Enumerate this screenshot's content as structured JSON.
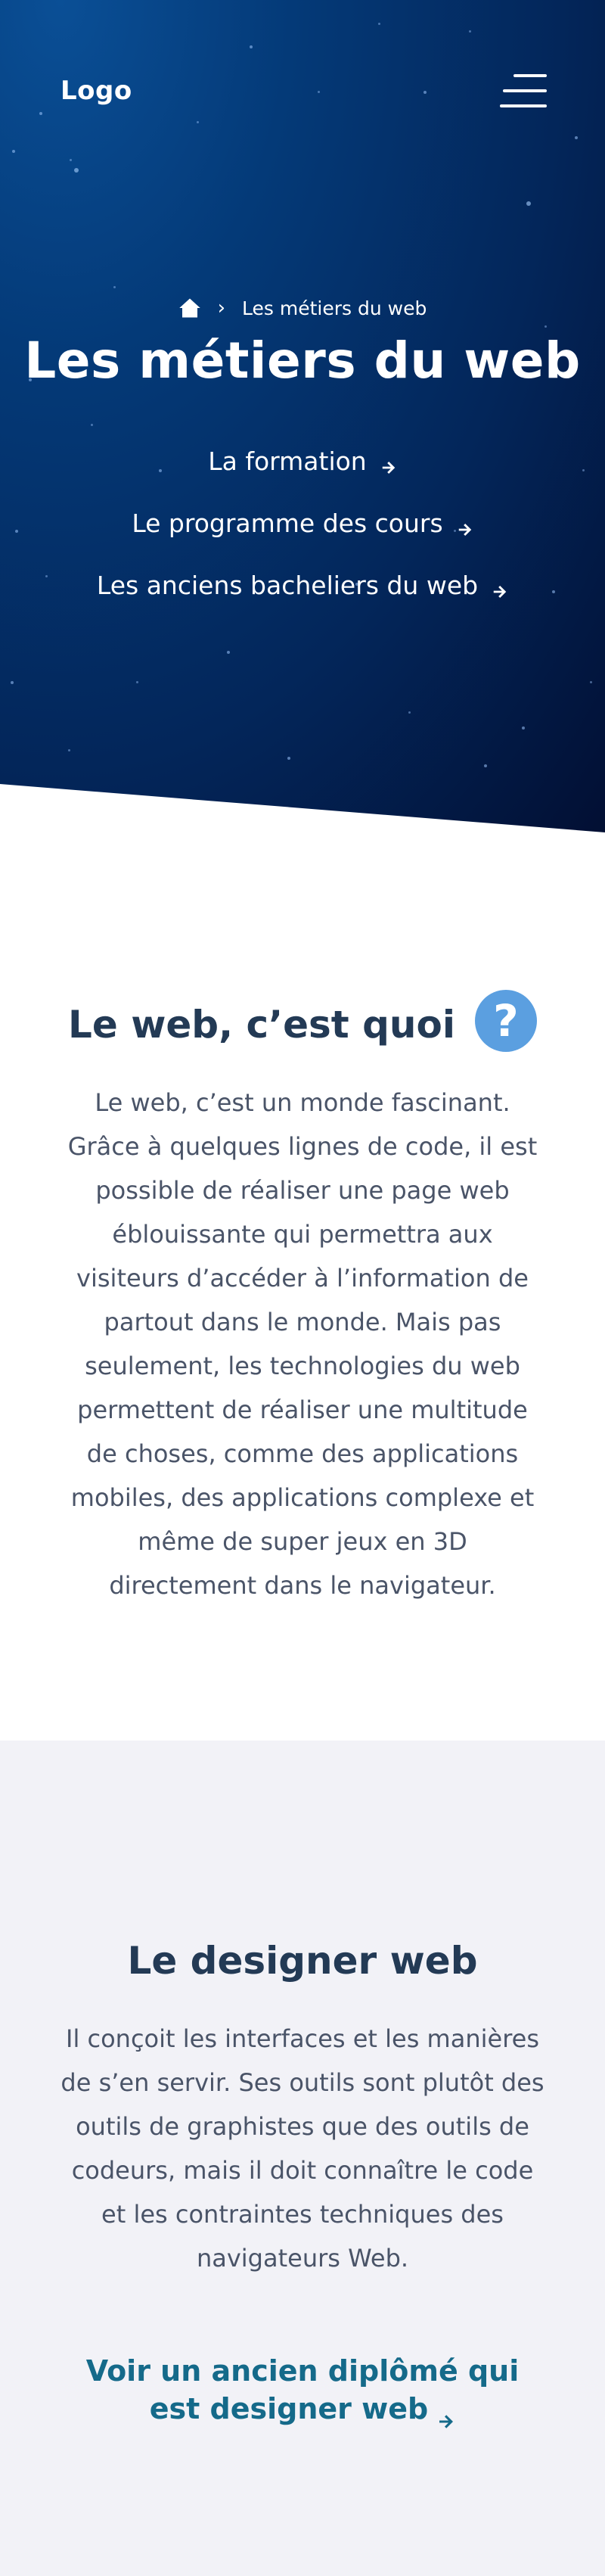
{
  "header": {
    "logo": "Logo",
    "menu_icon": "hamburger-menu-icon"
  },
  "hero": {
    "breadcrumb": {
      "home_icon": "home-icon",
      "separator": "›",
      "current": "Les métiers du web"
    },
    "title": "Les métiers du web",
    "links": [
      {
        "label": "La formation",
        "icon": "arrow-right-icon"
      },
      {
        "label": "Le programme des cours",
        "icon": "arrow-right-icon"
      },
      {
        "label": "Les anciens bacheliers du web",
        "icon": "arrow-right-icon"
      }
    ]
  },
  "section_web": {
    "title": "Le web, c’est quoi",
    "icon": "question-icon",
    "icon_glyph": "?",
    "body": "Le web, c’est un monde fascinant. Grâce à quelques lignes de code, il est possible de réaliser une page web éblouissante qui permettra aux visiteurs d’accéder à l’information de partout dans le monde. Mais pas seulement, les technologies du web permettent de réaliser une multitude de choses, comme des applications mobiles, des applications complexe et même de super jeux en 3D directement dans le navigateur."
  },
  "section_designer": {
    "title": "Le designer web",
    "body": "Il conçoit les interfaces et les manières de s’en servir. Ses outils sont plutôt des outils de graphistes que des outils de codeurs, mais il doit connaître le code et les contraintes techniques des navigateurs Web.",
    "link_label": "Voir un ancien diplômé qui est designer web",
    "link_icon": "arrow-right-icon"
  },
  "colors": {
    "hero_bg": "#043a78",
    "heading": "#233a55",
    "body_text": "#4a5468",
    "link": "#156a8a",
    "question_badge": "#5b9fe0",
    "section_alt_bg": "#f2f2f7"
  }
}
